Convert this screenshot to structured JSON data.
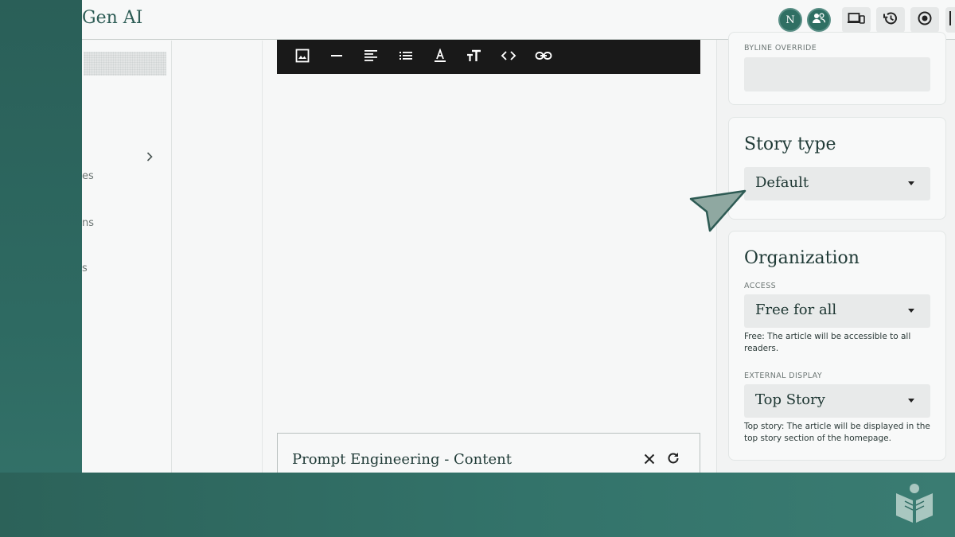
{
  "app": {
    "brand": "Gen AI",
    "avatar_initial": "N"
  },
  "topbar": {
    "icons": [
      "user-group-icon",
      "devices-icon",
      "history-icon",
      "target-icon"
    ]
  },
  "leftnav": {
    "fragments": [
      "es",
      "ns",
      "s"
    ]
  },
  "toolbar": {
    "tools": [
      "image-icon",
      "horizontal-rule-icon",
      "align-left-icon",
      "list-icon",
      "text-color-icon",
      "text-size-icon",
      "code-icon",
      "link-icon"
    ]
  },
  "prompt_panel": {
    "title": "Prompt Engineering - Content"
  },
  "right_panel": {
    "byline": {
      "label": "BYLINE OVERRIDE",
      "value": ""
    },
    "story_type": {
      "title": "Story type",
      "value": "Default"
    },
    "organization": {
      "title": "Organization",
      "access_label": "ACCESS",
      "access_value": "Free for all",
      "access_help": "Free: The article will be accessible to all readers.",
      "external_label": "EXTERNAL DISPLAY",
      "external_value": "Top Story",
      "external_help": "Top story: The article will be displayed in the top story section of the homepage."
    }
  },
  "colors": {
    "background": "#2f6a62",
    "accent": "#2d5c55",
    "toolbar": "#191919",
    "pointer": "#8fa8a1"
  }
}
